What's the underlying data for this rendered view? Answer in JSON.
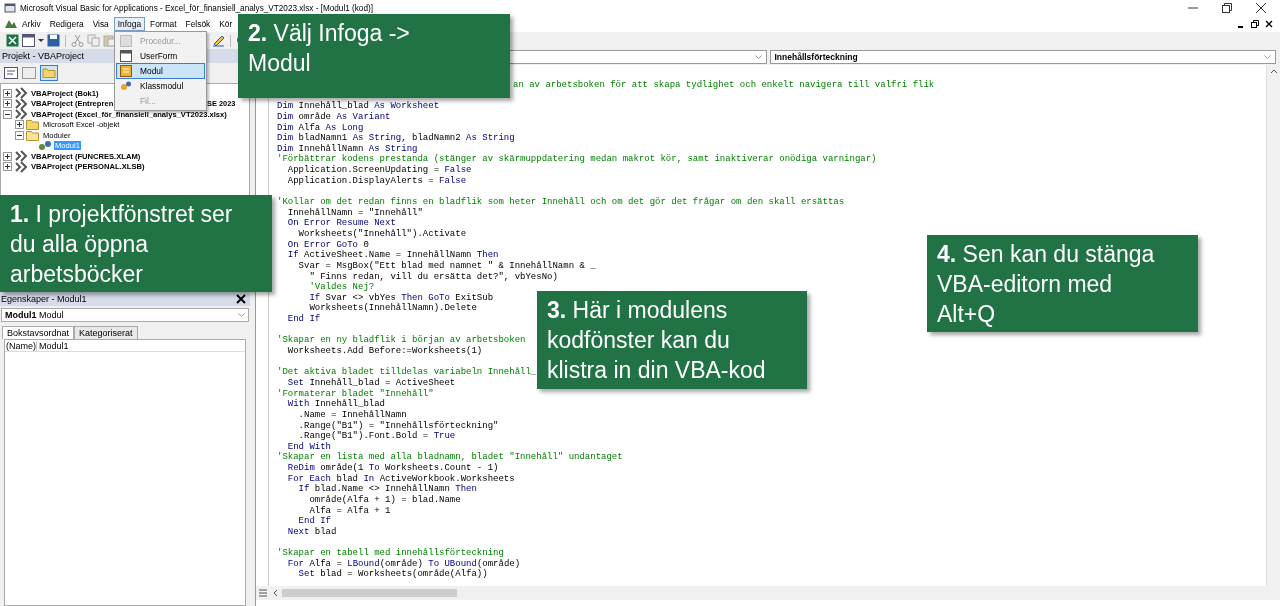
{
  "window": {
    "title": "Microsoft Visual Basic for Applications - Excel_för_finansiell_analys_VT2023.xlsx - [Modul1 (kod)]"
  },
  "menu": [
    {
      "label": "Arkiv",
      "open": false
    },
    {
      "label": "Redigera",
      "open": false
    },
    {
      "label": "Visa",
      "open": false
    },
    {
      "label": "Infoga",
      "open": true
    },
    {
      "label": "Format",
      "open": false
    },
    {
      "label": "Felsök",
      "open": false
    },
    {
      "label": "Kör",
      "open": false
    }
  ],
  "insert_menu": [
    {
      "label": "Procedur...",
      "kind": "procedure",
      "disabled": true,
      "selected": false
    },
    {
      "label": "UserForm",
      "kind": "form",
      "disabled": false,
      "selected": false
    },
    {
      "label": "Modul",
      "kind": "module",
      "disabled": false,
      "selected": true
    },
    {
      "label": "Klassmodul",
      "kind": "class",
      "disabled": false,
      "selected": false
    },
    {
      "label": "Fil...",
      "kind": "file",
      "disabled": true,
      "selected": false
    }
  ],
  "project": {
    "title": "Projekt - VBAProject",
    "tree": [
      {
        "label": "VBAProject (Bok1)",
        "kind": "project",
        "expanded": false,
        "selected": false
      },
      {
        "label": "VBAProject (Entrepren",
        "tail": "SE 2023",
        "kind": "project",
        "expanded": false,
        "selected": false
      },
      {
        "label": "VBAProject (Excel_för_finansiell_analys_VT2023.xlsx)",
        "kind": "project",
        "expanded": true,
        "selected": false,
        "children": [
          {
            "label": "Microsoft Excel -objekt",
            "kind": "folder",
            "expanded": false,
            "selected": false
          },
          {
            "label": "Moduler",
            "kind": "folder",
            "expanded": true,
            "selected": false,
            "children": [
              {
                "label": "Modul1",
                "kind": "module",
                "selected": true
              }
            ]
          }
        ]
      },
      {
        "label": "VBAProject (FUNCRES.XLAM)",
        "kind": "project",
        "expanded": false,
        "selected": false
      },
      {
        "label": "VBAProject (PERSONAL.XLSB)",
        "kind": "project",
        "expanded": false,
        "selected": false
      }
    ]
  },
  "properties": {
    "title": "Egenskaper - Modul1",
    "object_name": "Modul1",
    "object_type": "Modul",
    "tabs": [
      {
        "label": "Bokstavsordnat",
        "selected": true
      },
      {
        "label": "Kategoriserat",
        "selected": false
      }
    ],
    "rows": [
      {
        "name": "(Name)",
        "value": "Modul1"
      }
    ]
  },
  "code_window": {
    "procedure": "Innehållsförteckning",
    "covered_line": {
      "text": "an av arbetsboken för att skapa tydlighet och enkelt navigera till valfri flik",
      "kind": "comment"
    },
    "lines": [
      {
        "parts": [
          {
            "text": "Dim",
            "kind": "keyword"
          },
          {
            "text": " Innehåll_blad ",
            "kind": "plain"
          },
          {
            "text": "As Worksheet",
            "kind": "keyword"
          }
        ]
      },
      {
        "parts": [
          {
            "text": "Dim",
            "kind": "keyword"
          },
          {
            "text": " område ",
            "kind": "plain"
          },
          {
            "text": "As Variant",
            "kind": "keyword"
          }
        ]
      },
      {
        "parts": [
          {
            "text": "Dim",
            "kind": "keyword"
          },
          {
            "text": " Alfa ",
            "kind": "plain"
          },
          {
            "text": "As Long",
            "kind": "keyword"
          }
        ]
      },
      {
        "parts": [
          {
            "text": "Dim",
            "kind": "keyword"
          },
          {
            "text": " bladNamn1 ",
            "kind": "plain"
          },
          {
            "text": "As String",
            "kind": "keyword"
          },
          {
            "text": ", bladNamn2 ",
            "kind": "plain"
          },
          {
            "text": "As String",
            "kind": "keyword"
          }
        ]
      },
      {
        "parts": [
          {
            "text": "Dim",
            "kind": "keyword"
          },
          {
            "text": " InnehållNamn ",
            "kind": "plain"
          },
          {
            "text": "As String",
            "kind": "keyword"
          }
        ]
      },
      {
        "parts": [
          {
            "text": "'Förbättrar kodens prestanda (stänger av skärmuppdatering medan makrot kör, samt inaktiverar onödiga varningar)",
            "kind": "comment"
          }
        ]
      },
      {
        "parts": [
          {
            "text": "  Application.ScreenUpdating = ",
            "kind": "plain"
          },
          {
            "text": "False",
            "kind": "keyword"
          }
        ]
      },
      {
        "parts": [
          {
            "text": "  Application.DisplayAlerts = ",
            "kind": "plain"
          },
          {
            "text": "False",
            "kind": "keyword"
          }
        ]
      },
      {
        "kind": "blank"
      },
      {
        "parts": [
          {
            "text": "'Kollar om det redan finns en bladflik som heter Innehåll och om det gör det frågar om den skall ersättas",
            "kind": "comment"
          }
        ]
      },
      {
        "parts": [
          {
            "text": "  InnehållNamn = \"Innehåll\"",
            "kind": "plain"
          }
        ]
      },
      {
        "parts": [
          {
            "text": "  On Error Resume Next",
            "kind": "keyword"
          }
        ]
      },
      {
        "parts": [
          {
            "text": "    Worksheets(\"Innehåll\").Activate",
            "kind": "plain"
          }
        ]
      },
      {
        "parts": [
          {
            "text": "  On Error GoTo",
            "kind": "keyword"
          },
          {
            "text": " 0",
            "kind": "plain"
          }
        ]
      },
      {
        "parts": [
          {
            "text": "  If",
            "kind": "keyword"
          },
          {
            "text": " ActiveSheet.Name = InnehållNamn ",
            "kind": "plain"
          },
          {
            "text": "Then",
            "kind": "keyword"
          }
        ]
      },
      {
        "parts": [
          {
            "text": "    Svar = MsgBox(\"Ett blad med namnet \" & InnehållNamn & _",
            "kind": "plain"
          }
        ]
      },
      {
        "parts": [
          {
            "text": "      \" Finns redan, vill du ersätta det?\", vbYesNo)",
            "kind": "plain"
          }
        ]
      },
      {
        "parts": [
          {
            "text": "      'Valdes Nej?",
            "kind": "comment"
          }
        ]
      },
      {
        "parts": [
          {
            "text": "      If",
            "kind": "keyword"
          },
          {
            "text": " Svar <> vbYes ",
            "kind": "plain"
          },
          {
            "text": "Then GoTo",
            "kind": "keyword"
          },
          {
            "text": " ExitSub",
            "kind": "plain"
          }
        ]
      },
      {
        "parts": [
          {
            "text": "      Worksheets(InnehållNamn).Delete",
            "kind": "plain"
          }
        ]
      },
      {
        "parts": [
          {
            "text": "  End If",
            "kind": "keyword"
          }
        ]
      },
      {
        "kind": "blank"
      },
      {
        "parts": [
          {
            "text": "'Skapar en ny bladflik i början av arbetsboken",
            "kind": "comment"
          }
        ]
      },
      {
        "parts": [
          {
            "text": "  Worksheets.Add Before:=Worksheets(1)",
            "kind": "plain"
          }
        ]
      },
      {
        "kind": "blank"
      },
      {
        "parts": [
          {
            "text": "'Det aktiva bladet tilldelas variabeln Innehåll_",
            "kind": "comment"
          }
        ]
      },
      {
        "parts": [
          {
            "text": "  Set",
            "kind": "keyword"
          },
          {
            "text": " Innehåll_blad = ActiveSheet",
            "kind": "plain"
          }
        ]
      },
      {
        "parts": [
          {
            "text": "'Formaterar bladet \"Innehåll\"",
            "kind": "comment"
          }
        ]
      },
      {
        "parts": [
          {
            "text": "  With",
            "kind": "keyword"
          },
          {
            "text": " Innehåll_blad",
            "kind": "plain"
          }
        ]
      },
      {
        "parts": [
          {
            "text": "    .Name = InnehållNamn",
            "kind": "plain"
          }
        ]
      },
      {
        "parts": [
          {
            "text": "    .Range(\"B1\") = \"Innehållsförteckning\"",
            "kind": "plain"
          }
        ]
      },
      {
        "parts": [
          {
            "text": "    .Range(\"B1\").Font.Bold = ",
            "kind": "plain"
          },
          {
            "text": "True",
            "kind": "keyword"
          }
        ]
      },
      {
        "parts": [
          {
            "text": "  End With",
            "kind": "keyword"
          }
        ]
      },
      {
        "parts": [
          {
            "text": "'Skapar en lista med alla bladnamn, bladet \"Innehåll\" undantaget",
            "kind": "comment"
          }
        ]
      },
      {
        "parts": [
          {
            "text": "  ReDim",
            "kind": "keyword"
          },
          {
            "text": " område(1 ",
            "kind": "plain"
          },
          {
            "text": "To",
            "kind": "keyword"
          },
          {
            "text": " Worksheets.Count - 1)",
            "kind": "plain"
          }
        ]
      },
      {
        "parts": [
          {
            "text": "  For Each",
            "kind": "keyword"
          },
          {
            "text": " blad ",
            "kind": "plain"
          },
          {
            "text": "In",
            "kind": "keyword"
          },
          {
            "text": " ActiveWorkbook.Worksheets",
            "kind": "plain"
          }
        ]
      },
      {
        "parts": [
          {
            "text": "    If",
            "kind": "keyword"
          },
          {
            "text": " blad.Name <> InnehållNamn ",
            "kind": "plain"
          },
          {
            "text": "Then",
            "kind": "keyword"
          }
        ]
      },
      {
        "parts": [
          {
            "text": "      område(Alfa + 1) = blad.Name",
            "kind": "plain"
          }
        ]
      },
      {
        "parts": [
          {
            "text": "      Alfa = Alfa + 1",
            "kind": "plain"
          }
        ]
      },
      {
        "parts": [
          {
            "text": "    End If",
            "kind": "keyword"
          }
        ]
      },
      {
        "parts": [
          {
            "text": "  Next",
            "kind": "keyword"
          },
          {
            "text": " blad",
            "kind": "plain"
          }
        ]
      },
      {
        "kind": "blank"
      },
      {
        "parts": [
          {
            "text": "'Skapar en tabell med innehållsförteckning",
            "kind": "comment"
          }
        ]
      },
      {
        "parts": [
          {
            "text": "  For",
            "kind": "keyword"
          },
          {
            "text": " Alfa = ",
            "kind": "plain"
          },
          {
            "text": "LBound",
            "kind": "keyword"
          },
          {
            "text": "(område) ",
            "kind": "plain"
          },
          {
            "text": "To",
            "kind": "keyword"
          },
          {
            "text": " UBound",
            "kind": "keyword"
          },
          {
            "text": "(område)",
            "kind": "plain"
          }
        ]
      },
      {
        "parts": [
          {
            "text": "    Set",
            "kind": "keyword"
          },
          {
            "text": " blad = Worksheets(område(Alfa))",
            "kind": "plain"
          }
        ]
      }
    ]
  },
  "callouts": [
    {
      "number": "1.",
      "text": "I projektfönstret ser du alla öppna arbetsböcker"
    },
    {
      "number": "2.",
      "text": "Välj Infoga -> Modul"
    },
    {
      "number": "3.",
      "text": "Här i modulens kodfönster kan du klistra in din VBA-kod"
    },
    {
      "number": "4.",
      "text": "Sen kan du stänga VBA-editorn med Alt+Q"
    }
  ]
}
